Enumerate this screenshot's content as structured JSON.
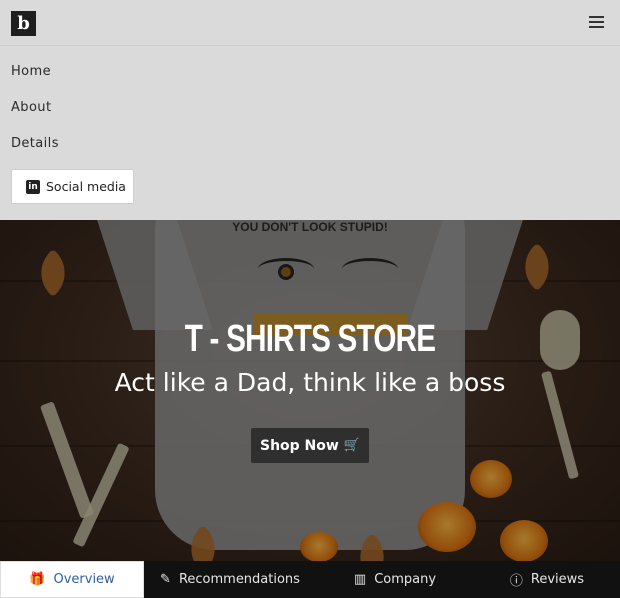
{
  "brand": {
    "logo_letter": "b"
  },
  "nav": {
    "menu": [
      "Home",
      "About",
      "Details"
    ],
    "social_label": "Social media",
    "social_icon": "linkedin-icon"
  },
  "hero": {
    "shirt_text": "YOU DON'T LOOK STUPID!",
    "title": "T - SHIRTS STORE",
    "subtitle": "Act like a Dad, think like a boss",
    "cta_label": "Shop Now",
    "cta_icon": "cart-icon"
  },
  "tabs": [
    {
      "label": "Overview",
      "icon": "gift-icon",
      "active": true
    },
    {
      "label": "Recommendations",
      "icon": "edit-icon",
      "active": false
    },
    {
      "label": "Company",
      "icon": "building-icon",
      "active": false
    },
    {
      "label": "Reviews",
      "icon": "info-icon",
      "active": false
    }
  ],
  "colors": {
    "nav_bg": "#dadada",
    "tab_active_text": "#2f5fa0",
    "tab_bar_bg": "#111111"
  }
}
